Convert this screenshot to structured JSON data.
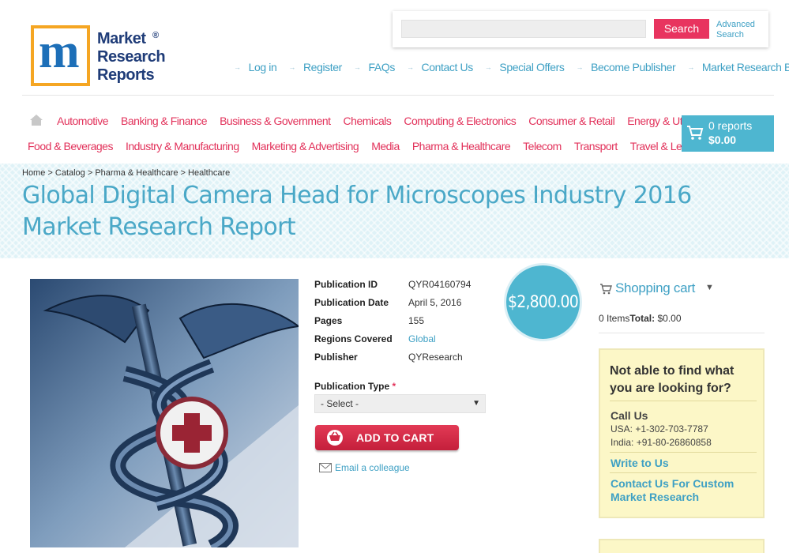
{
  "logo": {
    "letters": "m",
    "line1": "Market",
    "line2": "Research",
    "line3": "Reports",
    "mark": "®"
  },
  "search": {
    "placeholder": "",
    "button_label": "Search",
    "advanced_label": "Advanced Search"
  },
  "top_links": [
    "Log in",
    "Register",
    "FAQs",
    "Contact Us",
    "Special Offers",
    "Become Publisher",
    "Market Research Blog"
  ],
  "nav_row1": [
    "Automotive",
    "Banking & Finance",
    "Business & Government",
    "Chemicals",
    "Computing & Electronics",
    "Consumer & Retail",
    "Energy & Utilities"
  ],
  "nav_row2": [
    "Food & Beverages",
    "Industry & Manufacturing",
    "Marketing & Advertising",
    "Media",
    "Pharma & Healthcare",
    "Telecom",
    "Transport",
    "Travel & Leisure"
  ],
  "cart": {
    "count_text": "0 reports",
    "total_text": "$0.00"
  },
  "breadcrumb": "Home > Catalog > Pharma & Healthcare > Healthcare",
  "page_title": "Global Digital Camera Head for Microscopes Industry 2016 Market Research Report",
  "details": [
    {
      "label": "Publication ID",
      "value": "QYR04160794"
    },
    {
      "label": "Publication Date",
      "value": "April 5, 2016"
    },
    {
      "label": "Pages",
      "value": "155"
    },
    {
      "label": "Regions Covered",
      "value": "Global"
    },
    {
      "label": "Publisher",
      "value": "QYResearch"
    }
  ],
  "price": "$2,800.00",
  "publication_type": {
    "label": "Publication Type",
    "required_mark": "*",
    "selected": "- Select -"
  },
  "add_to_cart_label": "ADD TO CART",
  "email_colleague_label": "Email a colleague",
  "shopping_cart": {
    "title": "Shopping cart",
    "items_text": "0 Items",
    "total_label": "Total:",
    "total_value": " $0.00"
  },
  "help_box": {
    "question": "Not able to find what you are looking for?",
    "call_us": "Call Us",
    "usa_phone": "USA: +1-302-703-7787",
    "india_phone": "India: +91-80-26860858",
    "write_to_us": "Write to Us",
    "custom_research": "Contact Us For Custom Market Research"
  },
  "colors": {
    "accent_blue": "#4eb6d0",
    "link_blue": "#3ea0c4",
    "nav_pink": "#e2315a",
    "search_pink": "#e8345f",
    "help_bg": "#fcf7c7"
  }
}
